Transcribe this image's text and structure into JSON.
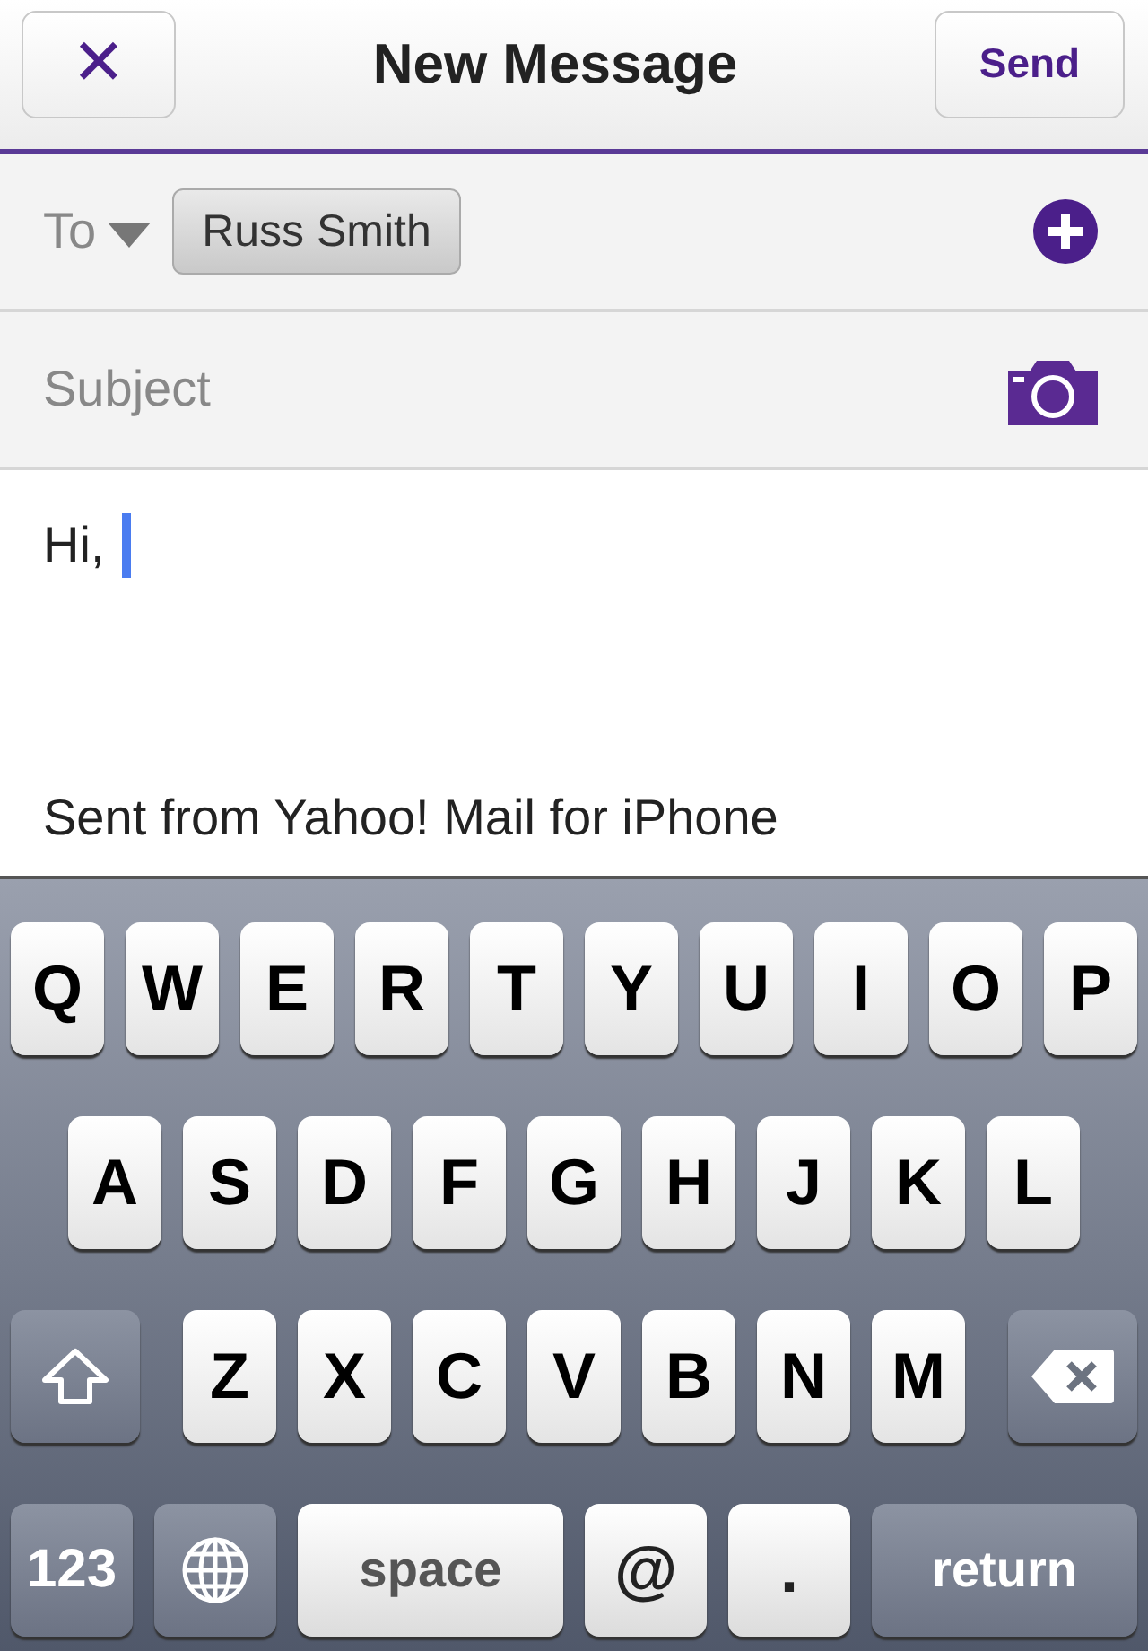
{
  "nav_bar": {
    "title": "New Message",
    "close_label": "✕",
    "send_label": "Send"
  },
  "to_field": {
    "label": "To",
    "recipients": [
      "Russ Smith"
    ]
  },
  "subject_field": {
    "placeholder": "Subject"
  },
  "body": {
    "text": "Hi,",
    "signature": "Sent from Yahoo! Mail for iPhone"
  },
  "keyboard": {
    "rows": [
      {
        "keys": [
          {
            "kind": "letter",
            "label": "Q"
          },
          {
            "kind": "letter",
            "label": "W"
          },
          {
            "kind": "letter",
            "label": "E"
          },
          {
            "kind": "letter",
            "label": "R"
          },
          {
            "kind": "letter",
            "label": "T"
          },
          {
            "kind": "letter",
            "label": "Y"
          },
          {
            "kind": "letter",
            "label": "U"
          },
          {
            "kind": "letter",
            "label": "I"
          },
          {
            "kind": "letter",
            "label": "O"
          },
          {
            "kind": "letter",
            "label": "P"
          }
        ]
      },
      {
        "keys": [
          {
            "kind": "letter",
            "label": "A"
          },
          {
            "kind": "letter",
            "label": "S"
          },
          {
            "kind": "letter",
            "label": "D"
          },
          {
            "kind": "letter",
            "label": "F"
          },
          {
            "kind": "letter",
            "label": "G"
          },
          {
            "kind": "letter",
            "label": "H"
          },
          {
            "kind": "letter",
            "label": "J"
          },
          {
            "kind": "letter",
            "label": "K"
          },
          {
            "kind": "letter",
            "label": "L"
          }
        ]
      },
      {
        "keys": [
          {
            "kind": "shift"
          },
          {
            "kind": "letter",
            "label": "Z"
          },
          {
            "kind": "letter",
            "label": "X"
          },
          {
            "kind": "letter",
            "label": "C"
          },
          {
            "kind": "letter",
            "label": "V"
          },
          {
            "kind": "letter",
            "label": "B"
          },
          {
            "kind": "letter",
            "label": "N"
          },
          {
            "kind": "letter",
            "label": "M"
          },
          {
            "kind": "backspace"
          }
        ]
      },
      {
        "keys": [
          {
            "kind": "numbers",
            "label": "123"
          },
          {
            "kind": "globe"
          },
          {
            "kind": "space",
            "label": "space"
          },
          {
            "kind": "symbol",
            "label": "@"
          },
          {
            "kind": "symbol",
            "label": "."
          },
          {
            "kind": "return",
            "label": "return"
          }
        ]
      }
    ]
  }
}
